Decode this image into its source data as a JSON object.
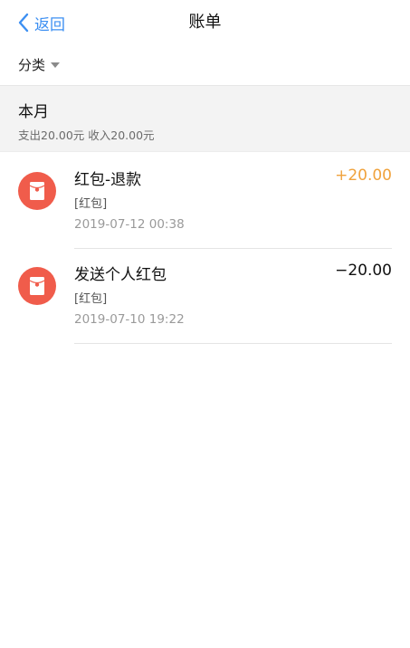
{
  "nav": {
    "back_label": "返回",
    "title": "账单"
  },
  "filter": {
    "label": "分类"
  },
  "month": {
    "title": "本月",
    "summary": "支出20.00元 收入20.00元"
  },
  "transactions": [
    {
      "title": "红包-退款",
      "tag": "[红包]",
      "time": "2019-07-12 00:38",
      "amount": "+20.00",
      "icon": "red-packet-icon"
    },
    {
      "title": "发送个人红包",
      "tag": "[红包]",
      "time": "2019-07-10 19:22",
      "amount": "−20.00",
      "icon": "red-packet-icon"
    }
  ],
  "colors": {
    "accent": "#3c8ff2",
    "red_packet": "#f05c4b",
    "income": "#f0a23c"
  }
}
